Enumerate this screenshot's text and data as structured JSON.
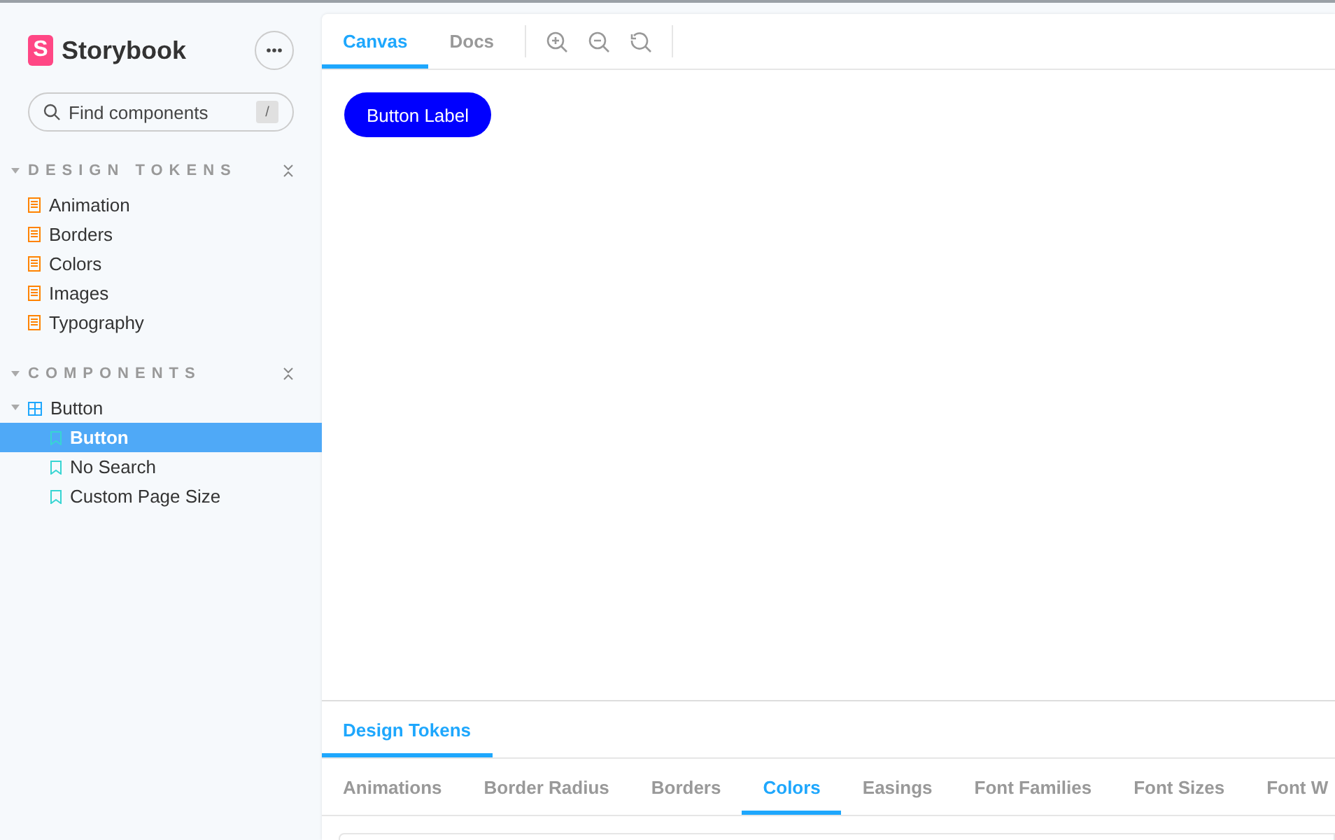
{
  "sidebar": {
    "logo_mark": "S",
    "brand": "Storybook",
    "search": {
      "placeholder": "Find components",
      "shortcut": "/"
    },
    "sections": [
      {
        "title": "DESIGN TOKENS",
        "expanded": true,
        "items": [
          {
            "kind": "doc",
            "label": "Animation",
            "selected": false
          },
          {
            "kind": "doc",
            "label": "Borders",
            "selected": false
          },
          {
            "kind": "doc",
            "label": "Colors",
            "selected": false
          },
          {
            "kind": "doc",
            "label": "Images",
            "selected": false
          },
          {
            "kind": "doc",
            "label": "Typography",
            "selected": false
          }
        ]
      },
      {
        "title": "COMPONENTS",
        "expanded": true,
        "items": [
          {
            "kind": "component",
            "label": "Button",
            "selected": false,
            "expanded": true,
            "children": [
              {
                "kind": "story",
                "label": "Button",
                "selected": true
              },
              {
                "kind": "story",
                "label": "No Search",
                "selected": false
              },
              {
                "kind": "story",
                "label": "Custom Page Size",
                "selected": false
              }
            ]
          }
        ]
      }
    ]
  },
  "toolbar": {
    "tabs": [
      {
        "label": "Canvas",
        "selected": true
      },
      {
        "label": "Docs",
        "selected": false
      }
    ]
  },
  "canvas": {
    "button_label": "Button Label"
  },
  "addons": {
    "tabs": [
      {
        "label": "Design Tokens",
        "selected": true
      }
    ],
    "subtabs": [
      {
        "label": "Animations",
        "selected": false
      },
      {
        "label": "Border Radius",
        "selected": false
      },
      {
        "label": "Borders",
        "selected": false
      },
      {
        "label": "Colors",
        "selected": true
      },
      {
        "label": "Easings",
        "selected": false
      },
      {
        "label": "Font Families",
        "selected": false
      },
      {
        "label": "Font Sizes",
        "selected": false
      },
      {
        "label": "Font W",
        "selected": false
      }
    ]
  }
}
